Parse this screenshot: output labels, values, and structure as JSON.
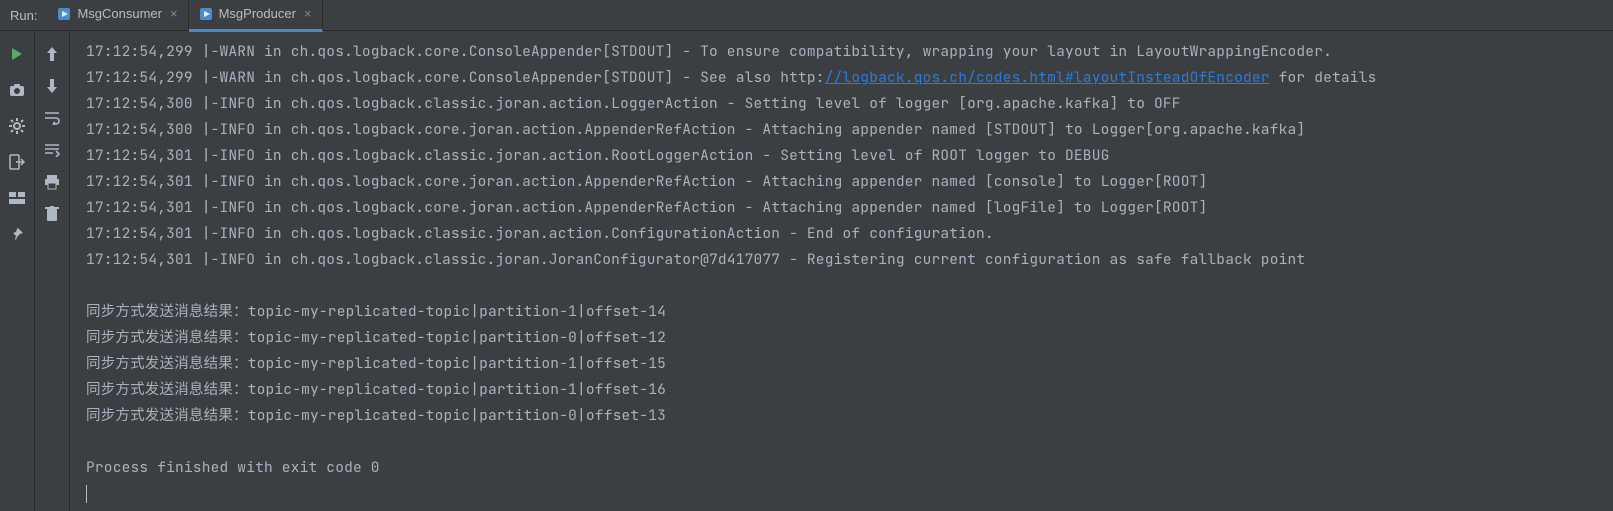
{
  "header": {
    "run_label": "Run:",
    "tabs": [
      {
        "label": "MsgConsumer",
        "active": false
      },
      {
        "label": "MsgProducer",
        "active": true
      }
    ]
  },
  "sidebar_left": {
    "items": [
      {
        "name": "run",
        "tooltip": "Run"
      },
      {
        "name": "camera",
        "tooltip": "Dump Threads"
      },
      {
        "name": "settings",
        "tooltip": "Edit Configuration"
      },
      {
        "name": "exit",
        "tooltip": "Exit"
      },
      {
        "name": "layout",
        "tooltip": "Layout"
      },
      {
        "name": "pin",
        "tooltip": "Pin Tab"
      }
    ]
  },
  "sidebar_second": {
    "items": [
      {
        "name": "up",
        "tooltip": "Up the stack trace"
      },
      {
        "name": "down",
        "tooltip": "Down the stack trace"
      },
      {
        "name": "soft-wrap",
        "tooltip": "Soft-Wrap"
      },
      {
        "name": "scroll-end",
        "tooltip": "Scroll to End"
      },
      {
        "name": "print",
        "tooltip": "Print"
      },
      {
        "name": "trash",
        "tooltip": "Clear All"
      }
    ]
  },
  "console": {
    "link_url": "//logback.qos.ch/codes.html#layoutInsteadOfEncoder",
    "lines": [
      {
        "text": "17:12:54,299 |-WARN in ch.qos.logback.core.ConsoleAppender[STDOUT] - To ensure compatibility, wrapping your layout in LayoutWrappingEncoder."
      },
      {
        "text_before": "17:12:54,299 |-WARN in ch.qos.logback.core.ConsoleAppender[STDOUT] - See also http:",
        "link_text": "//logback.qos.ch/codes.html#layoutInsteadOfEncoder",
        "text_after": " for details"
      },
      {
        "text": "17:12:54,300 |-INFO in ch.qos.logback.classic.joran.action.LoggerAction - Setting level of logger [org.apache.kafka] to OFF"
      },
      {
        "text": "17:12:54,300 |-INFO in ch.qos.logback.core.joran.action.AppenderRefAction - Attaching appender named [STDOUT] to Logger[org.apache.kafka]"
      },
      {
        "text": "17:12:54,301 |-INFO in ch.qos.logback.classic.joran.action.RootLoggerAction - Setting level of ROOT logger to DEBUG"
      },
      {
        "text": "17:12:54,301 |-INFO in ch.qos.logback.core.joran.action.AppenderRefAction - Attaching appender named [console] to Logger[ROOT]"
      },
      {
        "text": "17:12:54,301 |-INFO in ch.qos.logback.core.joran.action.AppenderRefAction - Attaching appender named [logFile] to Logger[ROOT]"
      },
      {
        "text": "17:12:54,301 |-INFO in ch.qos.logback.classic.joran.action.ConfigurationAction - End of configuration."
      },
      {
        "text": "17:12:54,301 |-INFO in ch.qos.logback.classic.joran.JoranConfigurator@7d417077 - Registering current configuration as safe fallback point"
      },
      {
        "text": ""
      },
      {
        "text": "同步方式发送消息结果：topic-my-replicated-topic|partition-1|offset-14"
      },
      {
        "text": "同步方式发送消息结果：topic-my-replicated-topic|partition-0|offset-12"
      },
      {
        "text": "同步方式发送消息结果：topic-my-replicated-topic|partition-1|offset-15"
      },
      {
        "text": "同步方式发送消息结果：topic-my-replicated-topic|partition-1|offset-16"
      },
      {
        "text": "同步方式发送消息结果：topic-my-replicated-topic|partition-0|offset-13"
      },
      {
        "text": ""
      },
      {
        "text": "Process finished with exit code 0"
      }
    ]
  },
  "icons": {
    "run_file": "run-config-icon",
    "close": "close-icon"
  }
}
